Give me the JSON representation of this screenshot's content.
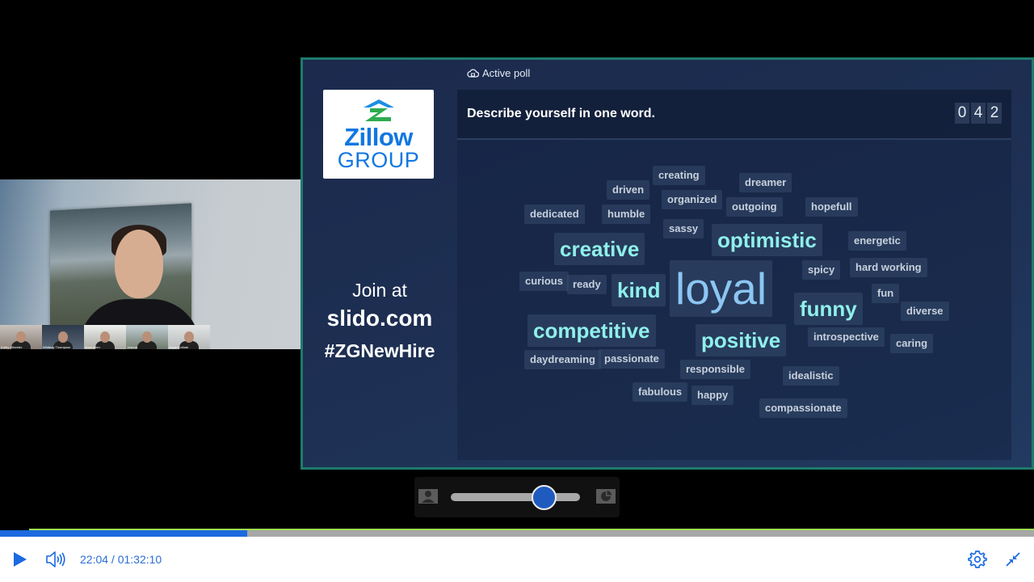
{
  "webcam": {
    "participants": [
      {
        "name": "Kathy Wheeler"
      },
      {
        "name": "Whitney Thompson"
      },
      {
        "name": "Mark Allen"
      },
      {
        "name": "Joshua"
      },
      {
        "name": "Aryan Kothari"
      }
    ]
  },
  "slide": {
    "logo": {
      "line1": "Zillow",
      "line2": "GROUP"
    },
    "join": {
      "line1": "Join at",
      "line2": "slido.com",
      "line3": "#ZGNewHire"
    },
    "active_poll_label": "Active poll",
    "question": "Describe yourself in one word.",
    "response_count_digits": [
      "0",
      "4",
      "2"
    ],
    "colors": {
      "border": "#1f7a6c",
      "large_word": "#8cc6f3",
      "medium_word": "#8ff0ea",
      "small_word": "#c7d0dc"
    },
    "words": [
      {
        "text": "creating",
        "size": "s"
      },
      {
        "text": "dreamer",
        "size": "s"
      },
      {
        "text": "driven",
        "size": "s"
      },
      {
        "text": "organized",
        "size": "s"
      },
      {
        "text": "outgoing",
        "size": "s"
      },
      {
        "text": "hopefull",
        "size": "s"
      },
      {
        "text": "dedicated",
        "size": "s"
      },
      {
        "text": "humble",
        "size": "s"
      },
      {
        "text": "sassy",
        "size": "s"
      },
      {
        "text": "creative",
        "size": "m"
      },
      {
        "text": "optimistic",
        "size": "m"
      },
      {
        "text": "energetic",
        "size": "s"
      },
      {
        "text": "spicy",
        "size": "s"
      },
      {
        "text": "hard working",
        "size": "s"
      },
      {
        "text": "curious",
        "size": "s"
      },
      {
        "text": "ready",
        "size": "s"
      },
      {
        "text": "kind",
        "size": "m"
      },
      {
        "text": "loyal",
        "size": "l"
      },
      {
        "text": "funny",
        "size": "m"
      },
      {
        "text": "fun",
        "size": "s"
      },
      {
        "text": "diverse",
        "size": "s"
      },
      {
        "text": "competitive",
        "size": "m"
      },
      {
        "text": "positive",
        "size": "m"
      },
      {
        "text": "introspective",
        "size": "s"
      },
      {
        "text": "caring",
        "size": "s"
      },
      {
        "text": "daydreaming",
        "size": "s"
      },
      {
        "text": "passionate",
        "size": "s"
      },
      {
        "text": "responsible",
        "size": "s"
      },
      {
        "text": "idealistic",
        "size": "s"
      },
      {
        "text": "fabulous",
        "size": "s"
      },
      {
        "text": "happy",
        "size": "s"
      },
      {
        "text": "compassionate",
        "size": "s"
      }
    ]
  },
  "layout_control": {
    "left_icon": "person-icon",
    "right_icon": "presentation-icon",
    "slider_fraction": 0.72
  },
  "player": {
    "current_time": "22:04",
    "duration": "01:32:10",
    "time_display": "22:04 / 01:32:10",
    "progress_fraction": 0.239,
    "accent": "#1c6ae0",
    "buffer_color": "#9ee054",
    "icons": [
      "play-icon",
      "volume-icon",
      "settings-icon",
      "exit-fullscreen-icon"
    ]
  }
}
